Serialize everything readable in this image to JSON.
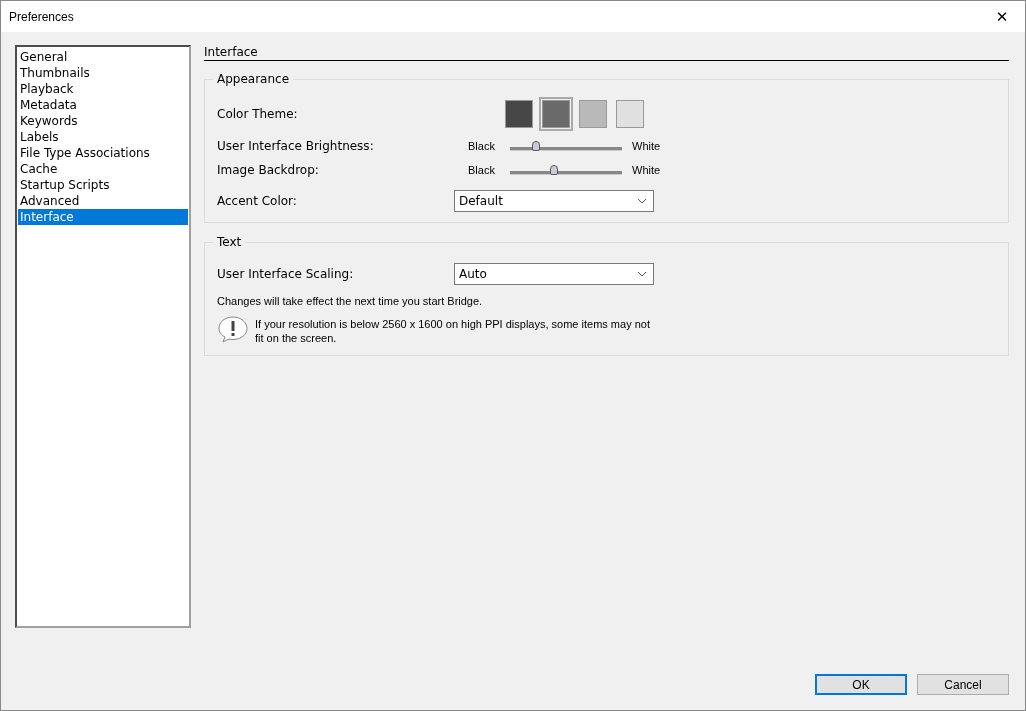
{
  "window": {
    "title": "Preferences",
    "close": "✕"
  },
  "sidebar": {
    "items": [
      {
        "label": "General",
        "selected": false
      },
      {
        "label": "Thumbnails",
        "selected": false
      },
      {
        "label": "Playback",
        "selected": false
      },
      {
        "label": "Metadata",
        "selected": false
      },
      {
        "label": "Keywords",
        "selected": false
      },
      {
        "label": "Labels",
        "selected": false
      },
      {
        "label": "File Type Associations",
        "selected": false
      },
      {
        "label": "Cache",
        "selected": false
      },
      {
        "label": "Startup Scripts",
        "selected": false
      },
      {
        "label": "Advanced",
        "selected": false
      },
      {
        "label": "Interface",
        "selected": true
      }
    ]
  },
  "page_title": "Interface",
  "appearance": {
    "title": "Appearance",
    "color_theme": {
      "label": "Color Theme:",
      "swatches": [
        {
          "color": "#474747",
          "selected": false
        },
        {
          "color": "#6a6a6a",
          "selected": true
        },
        {
          "color": "#b9b9b9",
          "selected": false
        },
        {
          "color": "#e0e0e0",
          "selected": false
        }
      ]
    },
    "sliders": [
      {
        "label": "User Interface Brightness:",
        "min_label": "Black",
        "max_label": "White",
        "level": 0.23
      },
      {
        "label": "Image Backdrop:",
        "min_label": "Black",
        "max_label": "White",
        "level": 0.39
      }
    ],
    "accent_color": {
      "label": "Accent Color:",
      "value": "Default"
    }
  },
  "text": {
    "title": "Text",
    "scaling": {
      "label": "User Interface Scaling:",
      "value": "Auto"
    },
    "note": "Changes will take effect the next time you start Bridge.",
    "warning": "If your resolution is below 2560 x 1600 on high PPI displays, some items may not fit on the screen."
  },
  "buttons": [
    {
      "label": "OK",
      "default": true
    },
    {
      "label": "Cancel",
      "default": false
    }
  ]
}
